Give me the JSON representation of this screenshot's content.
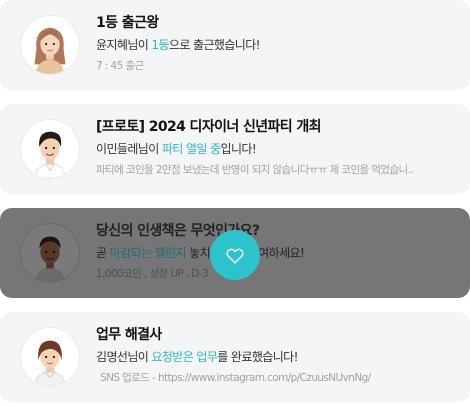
{
  "cards": [
    {
      "title": "1등 출근왕",
      "message_pre": "윤지혜님이 ",
      "message_highlight": "1등",
      "message_post": "으로 출근했습니다!",
      "sub": "7 : 45 출근",
      "avatar_icon": "woman-long-hair-avatar-icon"
    },
    {
      "title": "[프로토] 2024 디자이너 신년파티 개최",
      "message_pre": "이민들레님이 ",
      "message_highlight": "파티 열일 중",
      "message_post": "입니다!",
      "sub": "파티에 코인을 2만점 보냈는데 반영이 되지 않습니다ㅠㅠ 제 코인을 먹었습니..",
      "avatar_icon": "man-black-hair-avatar-icon"
    },
    {
      "title": "당신의 인생책은 무엇인가요?",
      "message_pre": "곧 ",
      "message_highlight": "마감되는 챌린지",
      "message_post": " 놓치지 말고 참여하세요!",
      "sub": "1,000코인 , 성장 UP , D-3",
      "avatar_icon": "man-dark-skin-avatar-icon"
    },
    {
      "title": "업무 해결사",
      "message_pre": "김명선님이 ",
      "message_highlight": "요청받은 업무",
      "message_post": "를 완료했습니다!",
      "sub": "SNS 업로드 - https://www.instagram.com/p/CzuusNUvnNg/",
      "avatar_icon": "woman-short-hair-avatar-icon"
    }
  ],
  "overlay": {
    "icon": "heart-outline-icon",
    "accent": "#2cc3cd"
  }
}
